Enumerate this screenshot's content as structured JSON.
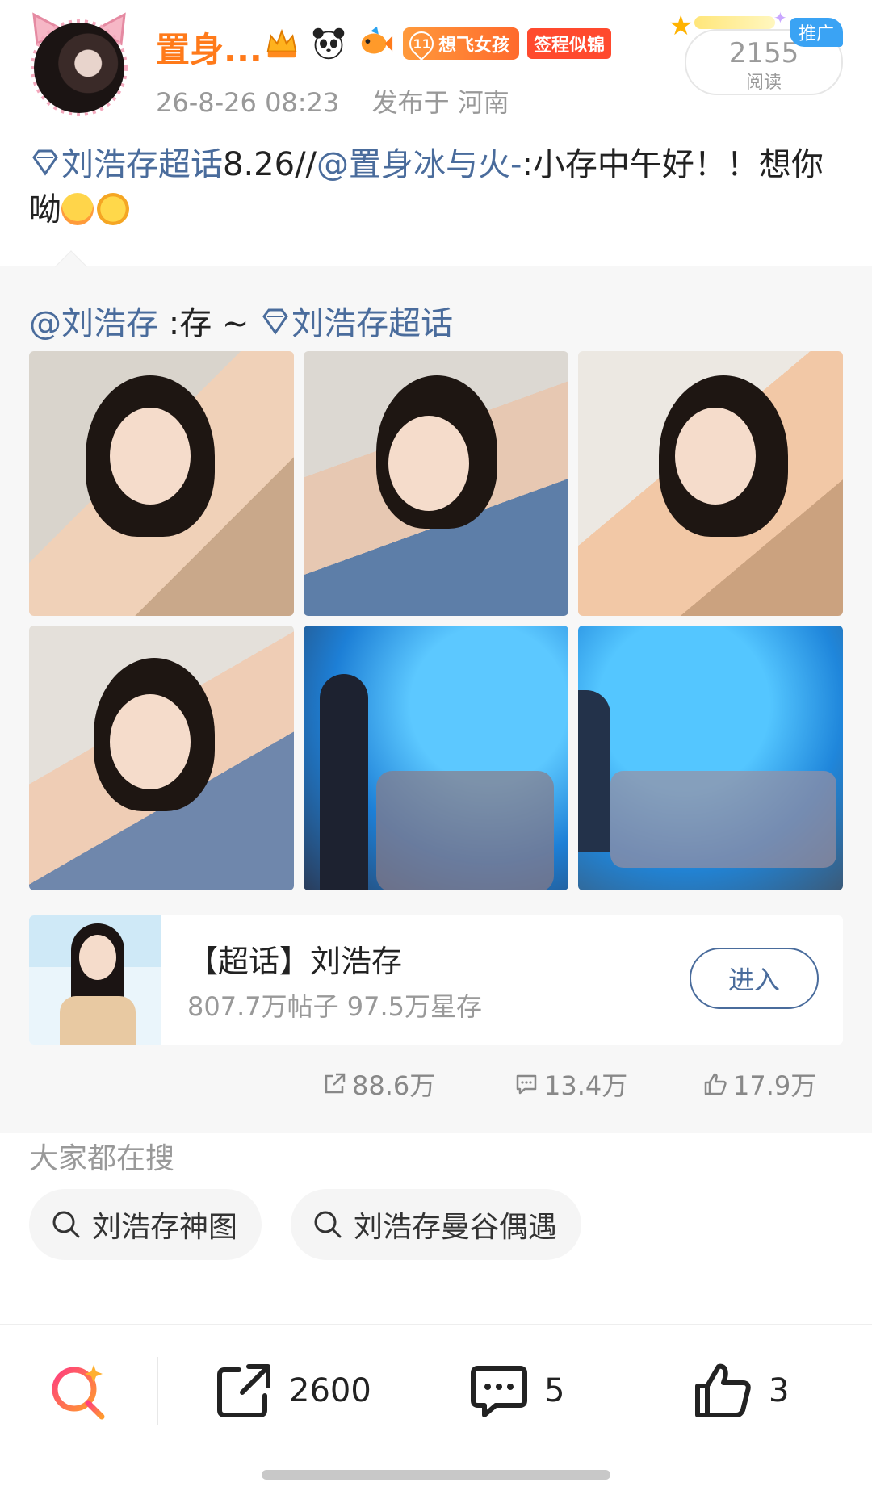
{
  "header": {
    "username": "置身...",
    "badges": {
      "fan_level": "11",
      "fan_group": "想飞女孩",
      "sign_badge": "签程似锦"
    },
    "timestamp": "26-8-26 08:23",
    "location": "发布于 河南",
    "views_count": "2155",
    "views_label": "阅读",
    "promo_label": "推广"
  },
  "post": {
    "topic": "刘浩存超话",
    "text_1": "8.26//",
    "mention": "@置身冰与火-",
    "text_2": ":小存中午好！！想你呦"
  },
  "repost": {
    "author": "@刘浩存",
    "text": " :存 ~ ",
    "topic": "刘浩存超话",
    "topic_card": {
      "title": "【超话】刘浩存",
      "stats": "807.7万帖子 97.5万星存",
      "enter_label": "进入"
    },
    "actions": {
      "shares": "88.6万",
      "comments": "13.4万",
      "likes": "17.9万"
    }
  },
  "search": {
    "title": "大家都在搜",
    "chips": [
      "刘浩存神图",
      "刘浩存曼谷偶遇"
    ]
  },
  "bottom_bar": {
    "repost_count": "2600",
    "comment_count": "5",
    "like_count": "3"
  },
  "colors": {
    "username": "#ff7a1a",
    "link": "#4a6c9c",
    "promo": "#3aa3f4",
    "search_icon_gradient": [
      "#ff3d7f",
      "#ff9a2e"
    ]
  }
}
